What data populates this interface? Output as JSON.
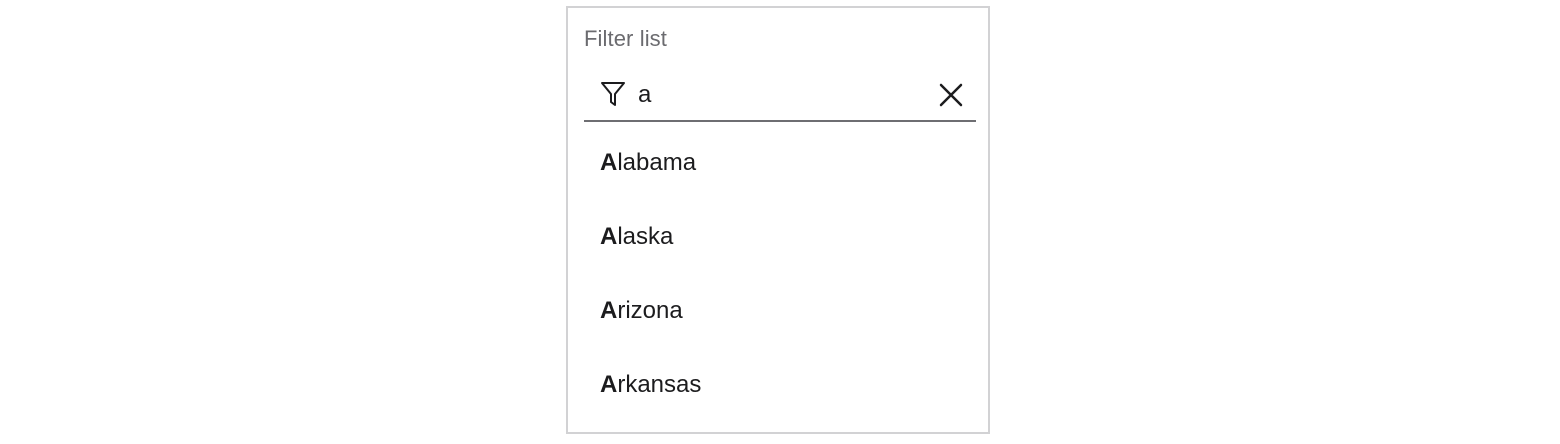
{
  "filter": {
    "label": "Filter list",
    "value": "a",
    "icon": "filter-icon",
    "clear_icon": "close-icon"
  },
  "results": [
    {
      "match": "A",
      "rest": "labama"
    },
    {
      "match": "A",
      "rest": "laska"
    },
    {
      "match": "A",
      "rest": "rizona"
    },
    {
      "match": "A",
      "rest": "rkansas"
    }
  ],
  "colors": {
    "border": "#d2d2d4",
    "label": "#6b6b6f",
    "text": "#1c1c1e",
    "underline": "#6e6e72"
  }
}
